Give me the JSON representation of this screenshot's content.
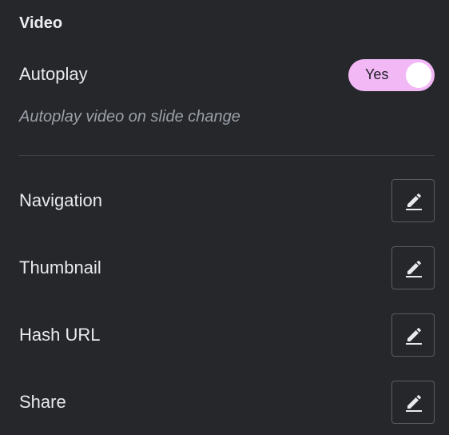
{
  "section": {
    "title": "Video"
  },
  "autoplay": {
    "label": "Autoplay",
    "toggle_label": "Yes",
    "enabled": true,
    "description": "Autoplay video on slide change"
  },
  "settings": [
    {
      "label": "Navigation",
      "icon": "pencil-icon"
    },
    {
      "label": "Thumbnail",
      "icon": "pencil-icon"
    },
    {
      "label": "Hash URL",
      "icon": "pencil-icon"
    },
    {
      "label": "Share",
      "icon": "pencil-icon"
    }
  ],
  "colors": {
    "background": "#26272b",
    "toggle_on": "#f2b8f6",
    "text": "#e9eaed",
    "muted_text": "#9aa0a8",
    "border": "#5a5d63"
  }
}
